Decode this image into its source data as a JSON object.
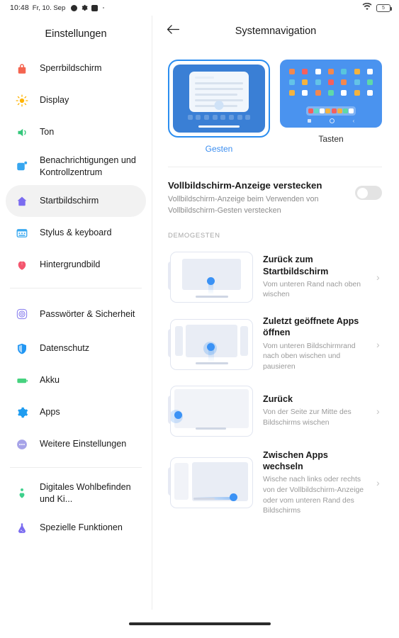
{
  "statusbar": {
    "time": "10:48",
    "date": "Fr, 10. Sep",
    "icons": [
      "dot-icon",
      "gear-icon",
      "square-icon",
      "tiny-dot-icon"
    ],
    "wifi": "wifi-icon",
    "battery_level": "5"
  },
  "sidebar": {
    "title": "Einstellungen",
    "groups": [
      {
        "items": [
          {
            "label": "Sperrbildschirm",
            "icon": "lock-icon",
            "color": "#f4644f",
            "active": false
          },
          {
            "label": "Display",
            "icon": "brightness-icon",
            "color": "#ffb300",
            "active": false
          },
          {
            "label": "Ton",
            "icon": "speaker-icon",
            "color": "#34c77b",
            "active": false
          },
          {
            "label": "Benachrichtigungen und Kontrollzentrum",
            "icon": "notification-icon",
            "color": "#37a6ef",
            "active": false
          },
          {
            "label": "Startbildschirm",
            "icon": "home-icon",
            "color": "#7b6cf0",
            "active": true
          },
          {
            "label": "Stylus & keyboard",
            "icon": "keyboard-icon",
            "color": "#3aa9f0",
            "active": false
          },
          {
            "label": "Hintergrundbild",
            "icon": "flower-icon",
            "color": "#f4566e",
            "active": false
          }
        ]
      },
      {
        "items": [
          {
            "label": "Passwörter & Sicherheit",
            "icon": "fingerprint-icon",
            "color": "#8f86ef",
            "active": false
          },
          {
            "label": "Datenschutz",
            "icon": "shield-icon",
            "color": "#2196f3",
            "active": false
          },
          {
            "label": "Akku",
            "icon": "battery-icon",
            "color": "#46d27f",
            "active": false
          },
          {
            "label": "Apps",
            "icon": "gear-icon",
            "color": "#1f9cf0",
            "active": false
          },
          {
            "label": "Weitere Einstellungen",
            "icon": "more-icon",
            "color": "#a6a3e8",
            "active": false
          }
        ]
      },
      {
        "items": [
          {
            "label": "Digitales Wohlbefinden und Ki...",
            "icon": "wellbeing-icon",
            "color": "#3ed08c",
            "active": false
          },
          {
            "label": "Spezielle Funktionen",
            "icon": "flask-icon",
            "color": "#7b6cf0",
            "active": false
          }
        ]
      }
    ]
  },
  "main": {
    "back_icon": "back-arrow-icon",
    "title": "Systemnavigation",
    "modes": [
      {
        "key": "gestures",
        "label": "Gesten",
        "selected": true
      },
      {
        "key": "buttons",
        "label": "Tasten",
        "selected": false
      }
    ],
    "toggle": {
      "title": "Vollbildschirm-Anzeige verstecken",
      "subtitle": "Vollbildschirm-Anzeige beim Verwenden von Vollbildschirm-Gesten verstecken",
      "state": "off"
    },
    "section_label": "DEMOGESTEN",
    "gestures": [
      {
        "title": "Zurück zum Startbildschirm",
        "subtitle": "Vom unteren Rand nach oben wischen",
        "thumb": "swipe-up-home-thumb",
        "chevron": "chevron-right-icon"
      },
      {
        "title": "Zuletzt geöffnete Apps öffnen",
        "subtitle": "Vom unteren Bildschirmrand nach oben wischen und pausieren",
        "thumb": "swipe-up-hold-thumb",
        "chevron": "chevron-right-icon"
      },
      {
        "title": "Zurück",
        "subtitle": "Von der Seite zur Mitte des Bildschirms wischen",
        "thumb": "swipe-side-back-thumb",
        "chevron": "chevron-right-icon"
      },
      {
        "title": "Zwischen Apps wechseln",
        "subtitle": "Wische nach links oder rechts von der Vollbildschirm-Anzeige oder vom unteren Rand des Bildschirms",
        "thumb": "swipe-switch-apps-thumb",
        "chevron": "chevron-right-icon"
      }
    ]
  },
  "home_indicator": "home-indicator-bar",
  "colors": {
    "accent": "#3b8ef0",
    "thumb_blue": "#3a7fd5",
    "grid_blue": "#4a93ef",
    "selected_bg": "#f2f2f2",
    "divider": "#ececec"
  },
  "thumb_grid_colors": [
    [
      "#f2884f",
      "#f4605f",
      "#ffffff",
      "#f2884f",
      "#58c5dd",
      "#f3b33f",
      "#ffffff"
    ],
    [
      "#63c3e8",
      "#f3b33f",
      "#63c3e8",
      "#f4605f",
      "#f2884f",
      "#63c3e8",
      "#5fd9a8"
    ],
    [
      "#f3b33f",
      "#ffffff",
      "#f2884f",
      "#5fd9a8",
      "#ffffff",
      "#f3b33f",
      "#ffffff"
    ]
  ],
  "thumb_dock_colors": [
    "#f4605f",
    "#5fd9c8",
    "#ffffff",
    "#f3b33f",
    "#f4605f",
    "#f3b33f",
    "#5fd9a8",
    "#ffffff"
  ]
}
